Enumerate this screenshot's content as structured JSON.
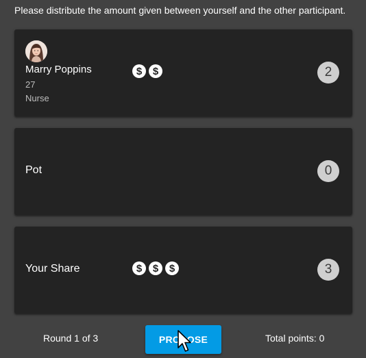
{
  "instructions": "Please distribute the amount given between yourself and the other participant.",
  "participant": {
    "name": "Marry Poppins",
    "age": "27",
    "occupation": "Nurse",
    "coin_count": 2,
    "coin_symbol": "$",
    "count": "2"
  },
  "pot": {
    "label": "Pot",
    "coin_count": 0,
    "count": "0"
  },
  "share": {
    "label": "Your Share",
    "coin_count": 3,
    "coin_symbol": "$",
    "count": "3"
  },
  "footer": {
    "round_text": "Round 1 of 3",
    "propose_label": "PROPOSE",
    "total_text": "Total points: 0"
  },
  "colors": {
    "background": "#424242",
    "card": "#232323",
    "primary_button": "#039be5",
    "badge": "#cfcfcf"
  }
}
